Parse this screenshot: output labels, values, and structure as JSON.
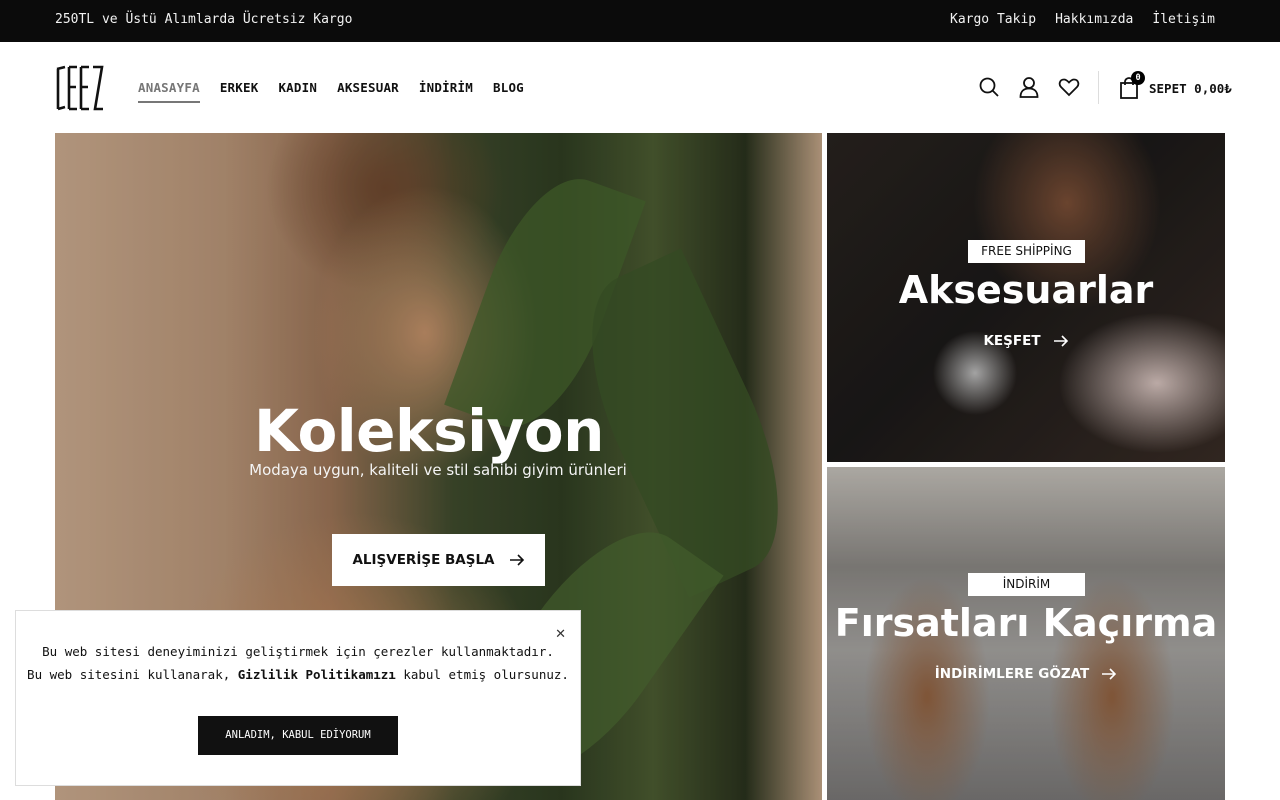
{
  "topbar": {
    "promo": "250TL ve Üstü Alımlarda Ücretsiz Kargo",
    "links": [
      "Kargo Takip",
      "Hakkımızda",
      "İletişim"
    ]
  },
  "header": {
    "logo_icon": "brand-logo",
    "nav": [
      "ANASAYFA",
      "ERKEK",
      "KADIN",
      "AKSESUAR",
      "İNDİRİM",
      "BLOG"
    ],
    "active_nav": "ANASAYFA",
    "icons": [
      "search-icon",
      "user-icon",
      "heart-icon"
    ],
    "cart": {
      "label": "SEPET",
      "total": "0,00₺",
      "count": "0"
    }
  },
  "hero": {
    "title": "Koleksiyon",
    "subtitle": "Modaya uygun, kaliteli ve stil sahibi giyim ürünleri",
    "button": "ALIŞVERİŞE BAŞLA"
  },
  "cards": [
    {
      "tag": "FREE SHİPPİNG",
      "title": "Aksesuarlar",
      "link": "KEŞFET"
    },
    {
      "tag": "İNDİRİM",
      "title": "Fırsatları Kaçırma",
      "link": "İNDİRİMLERE GÖZAT"
    }
  ],
  "cookie": {
    "line1": "Bu web sitesi deneyiminizi geliştirmek için çerezler kullanmaktadır.",
    "line2_prefix": "Bu web sitesini kullanarak,",
    "line2_link": "Gizlilik Politikamızı",
    "line2_suffix": "kabul etmiş olursunuz.",
    "accept": "ANLADIM, KABUL EDİYORUM"
  },
  "colors": {
    "topbar_bg": "#0b0b0b",
    "button_dark": "#111111",
    "active_nav": "#777777"
  }
}
